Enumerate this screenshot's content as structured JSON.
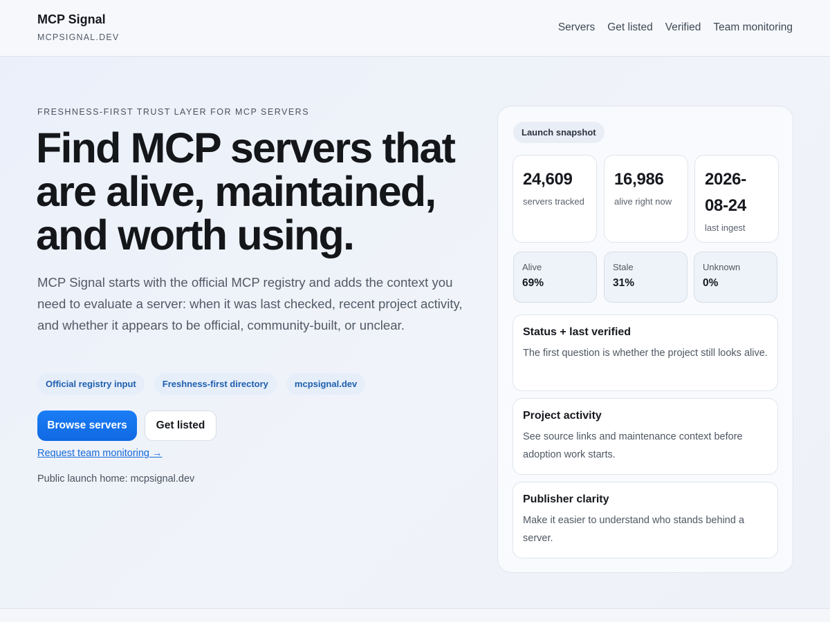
{
  "header": {
    "brand_name": "MCP Signal",
    "brand_domain": "MCPSIGNAL.DEV",
    "nav": [
      "Servers",
      "Get listed",
      "Verified",
      "Team monitoring"
    ]
  },
  "hero": {
    "eyebrow": "FRESHNESS-FIRST TRUST LAYER FOR MCP SERVERS",
    "headline": "Find MCP servers that are alive, maintained, and worth using.",
    "lede": "MCP Signal starts with the official MCP registry and adds the context you need to evaluate a server: when it was last checked, recent project activity, and whether it appears to be official, community-built, or unclear.",
    "chips": [
      "Official registry input",
      "Freshness-first directory",
      "mcpsignal.dev"
    ],
    "primary_button": "Browse servers",
    "secondary_button": "Get listed",
    "team_link": "Request team monitoring →",
    "public_note": "Public launch home: mcpsignal.dev"
  },
  "snapshot": {
    "badge": "Launch snapshot",
    "stats": [
      {
        "value": "24,609",
        "label": "servers tracked"
      },
      {
        "value": "16,986",
        "label": "alive right now"
      },
      {
        "value": "2026-08-24",
        "label": "last ingest"
      }
    ],
    "ratios": [
      {
        "label": "Alive",
        "value": "69%"
      },
      {
        "label": "Stale",
        "value": "31%"
      },
      {
        "label": "Unknown",
        "value": "0%"
      }
    ],
    "features": [
      {
        "title": "Status + last verified",
        "body": "The first question is whether the project still looks alive."
      },
      {
        "title": "Project activity",
        "body": "See source links and maintenance context before adoption work starts."
      },
      {
        "title": "Publisher clarity",
        "body": "Make it easier to understand who stands behind a server."
      }
    ]
  },
  "colors": {
    "accent": "#1a7df5",
    "link": "#1569d6",
    "chip_text": "#1f5fae",
    "chip_bg": "#e6eef9"
  }
}
